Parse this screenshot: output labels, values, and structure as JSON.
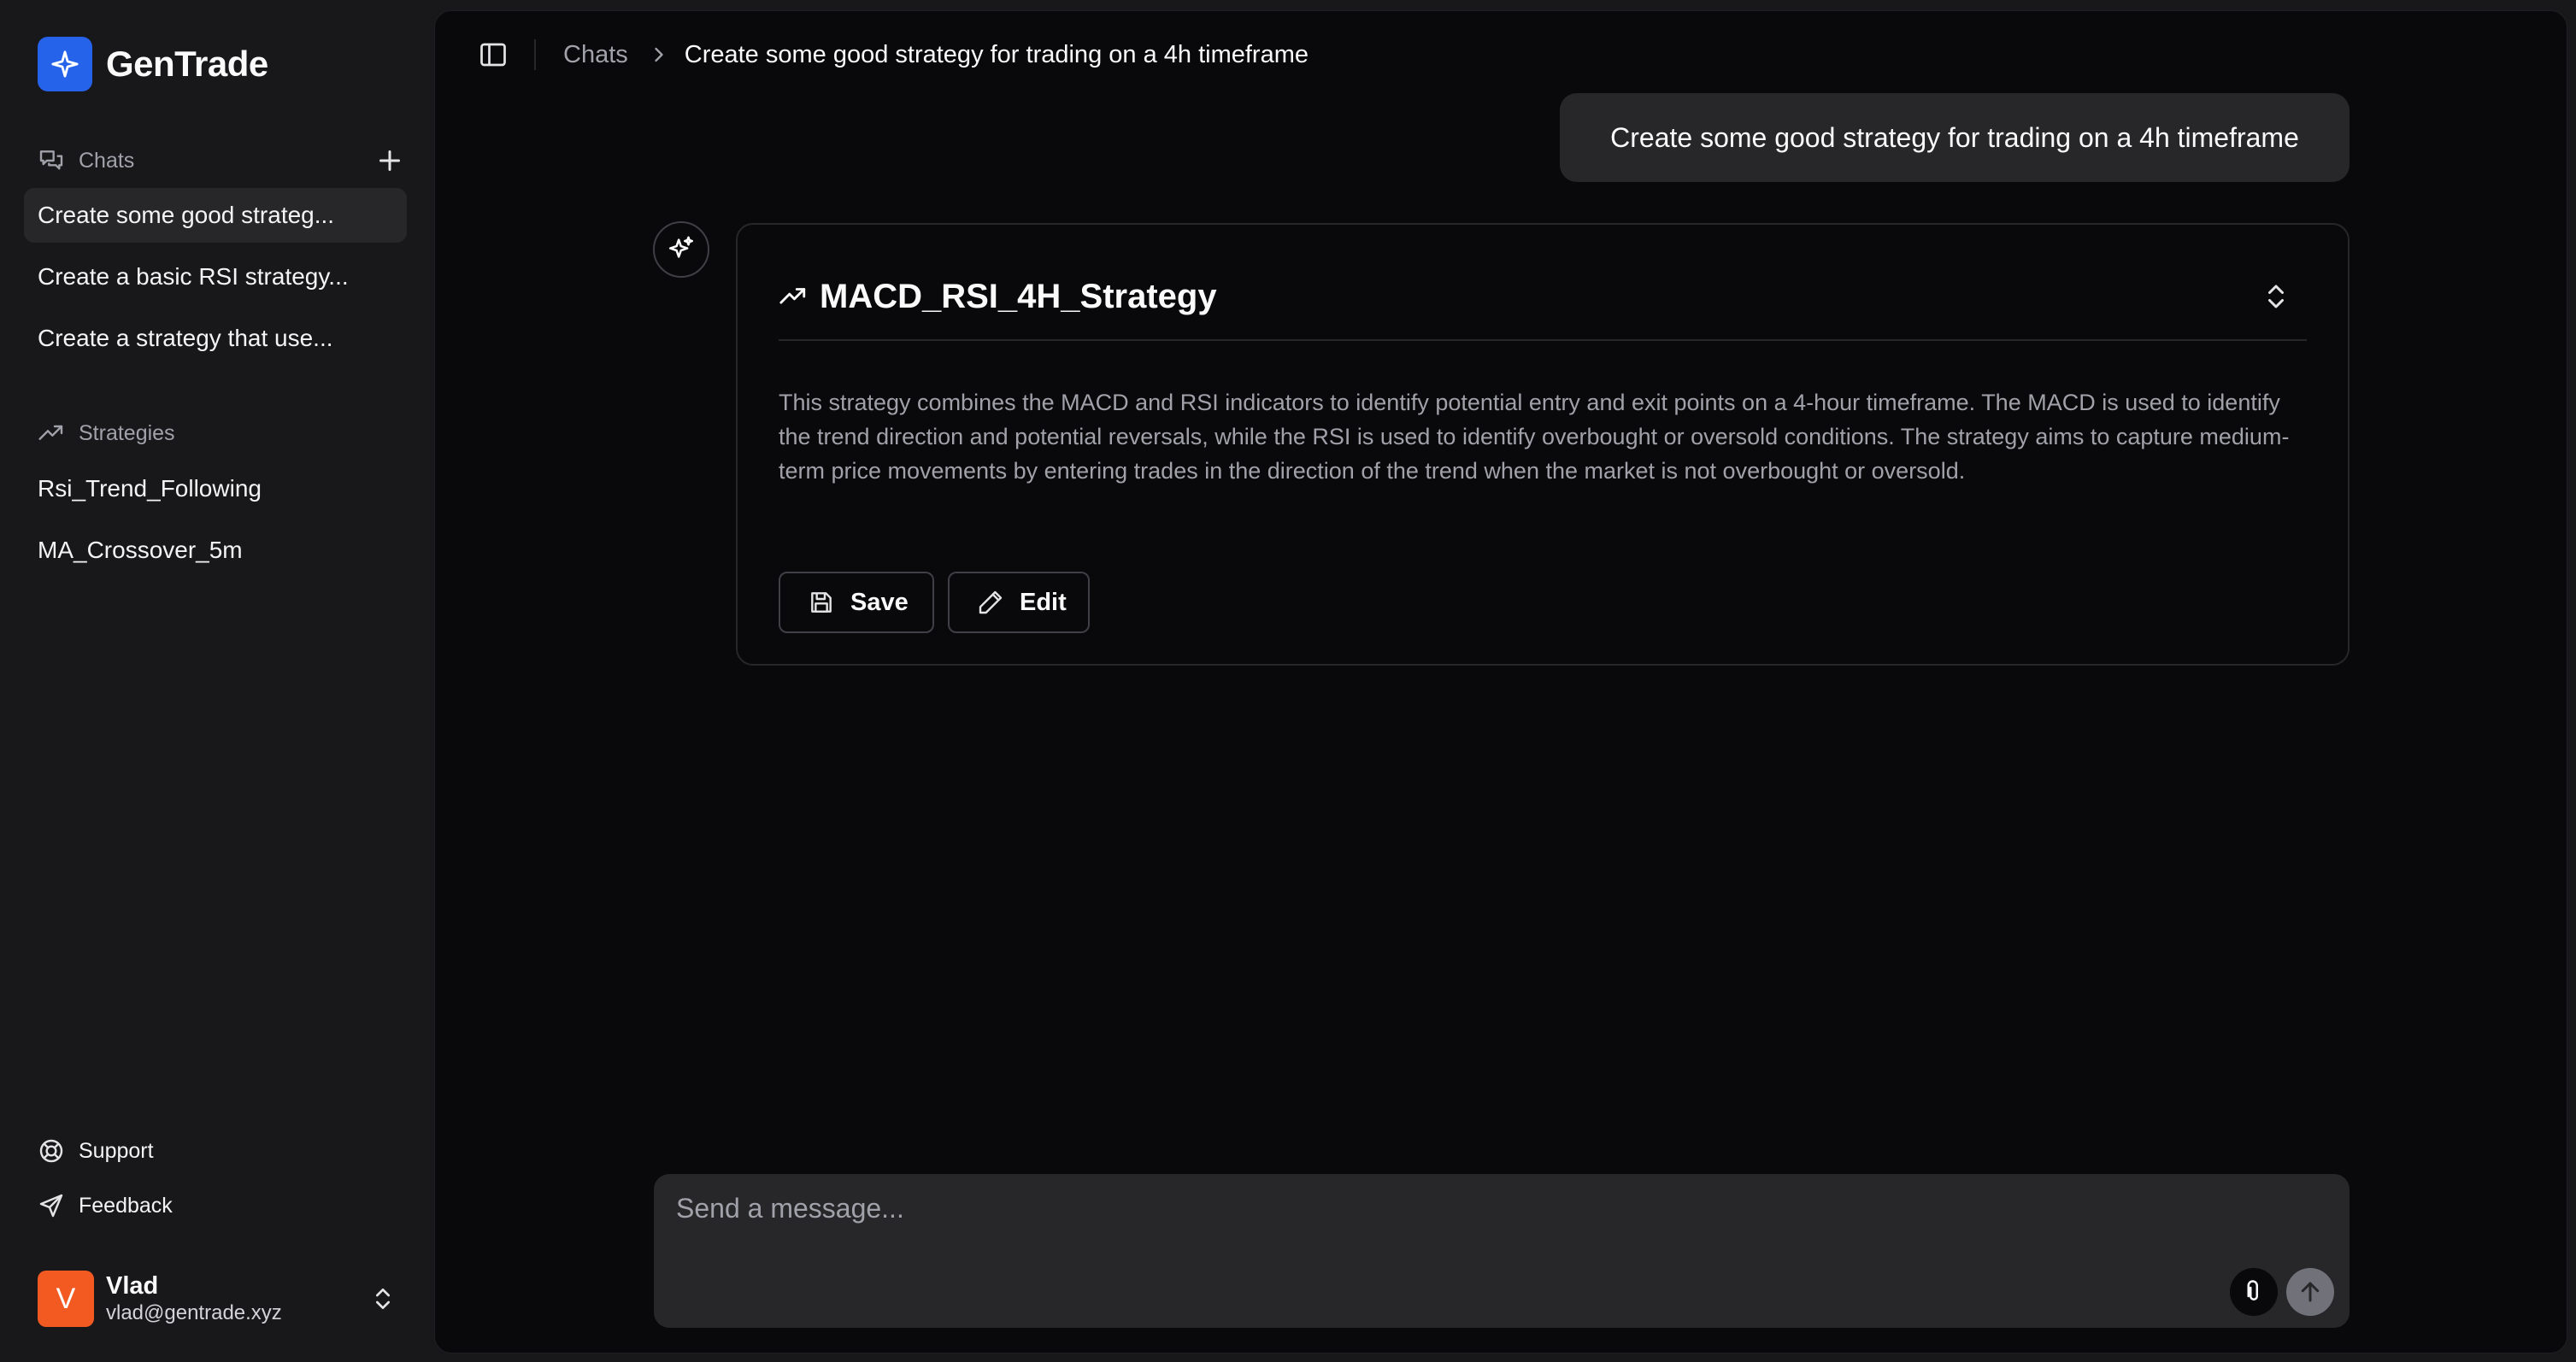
{
  "app": {
    "name": "GenTrade",
    "logo_icon": "sparkle-icon",
    "accent_color": "#2563eb"
  },
  "sidebar": {
    "chats": {
      "label": "Chats",
      "items": [
        {
          "label": "Create some good strateg...",
          "active": true
        },
        {
          "label": "Create a basic RSI strategy..."
        },
        {
          "label": "Create a strategy that use..."
        }
      ]
    },
    "strategies": {
      "label": "Strategies",
      "items": [
        {
          "label": "Rsi_Trend_Following"
        },
        {
          "label": "MA_Crossover_5m"
        }
      ]
    },
    "footer": {
      "support_label": "Support",
      "feedback_label": "Feedback"
    },
    "user": {
      "initial": "V",
      "name": "Vlad",
      "email": "vlad@gentrade.xyz",
      "avatar_color": "#f25a22"
    }
  },
  "header": {
    "breadcrumb": {
      "root": "Chats",
      "current": "Create some good strategy for trading on a 4h timeframe"
    }
  },
  "conversation": {
    "user_message": "Create some good strategy for trading on a 4h timeframe",
    "strategy_card": {
      "title": "MACD_RSI_4H_Strategy",
      "description": "This strategy combines the MACD and RSI indicators to identify potential entry and exit points on a 4-hour timeframe. The MACD is used to identify the trend direction and potential reversals, while the RSI is used to identify overbought or oversold conditions. The strategy aims to capture medium-term price movements by entering trades in the direction of the trend when the market is not overbought or oversold.",
      "save_label": "Save",
      "edit_label": "Edit"
    }
  },
  "composer": {
    "placeholder": "Send a message..."
  }
}
